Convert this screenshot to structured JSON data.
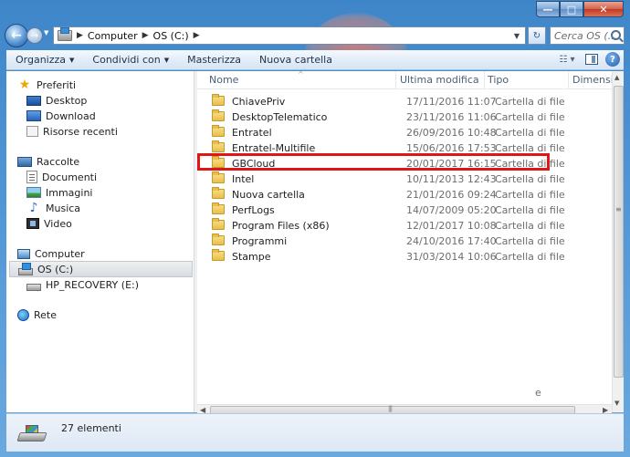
{
  "window": {
    "caption_buttons": {
      "minimize": "—",
      "maximize": "□",
      "close": "✕"
    }
  },
  "address_bar": {
    "path": [
      "Computer",
      "OS (C:)"
    ],
    "search_placeholder": "Cerca OS (..."
  },
  "toolbar": {
    "organize_label": "Organizza",
    "share_label": "Condividi con",
    "burn_label": "Masterizza",
    "new_folder_label": "Nuova cartella"
  },
  "nav_pane": {
    "favorites_label": "Preferiti",
    "favorites": [
      "Desktop",
      "Download",
      "Risorse recenti"
    ],
    "libraries_label": "Raccolte",
    "libraries": [
      "Documenti",
      "Immagini",
      "Musica",
      "Video"
    ],
    "computer_label": "Computer",
    "drives": [
      "OS (C:)",
      "HP_RECOVERY (E:)"
    ],
    "network_label": "Rete"
  },
  "file_list": {
    "columns": {
      "name": "Nome",
      "modified": "Ultima modifica",
      "type": "Tipo",
      "size": "Dimensio"
    },
    "rows": [
      {
        "name": "ChiavePriv",
        "modified": "17/11/2016 11:07",
        "type": "Cartella di file"
      },
      {
        "name": "DesktopTelematico",
        "modified": "23/11/2016 11:06",
        "type": "Cartella di file"
      },
      {
        "name": "Entratel",
        "modified": "26/09/2016 10:48",
        "type": "Cartella di file"
      },
      {
        "name": "Entratel-Multifile",
        "modified": "15/06/2016 17:53",
        "type": "Cartella di file"
      },
      {
        "name": "GBCloud",
        "modified": "20/01/2017 16:15",
        "type": "Cartella di file"
      },
      {
        "name": "Intel",
        "modified": "10/11/2013 12:43",
        "type": "Cartella di file"
      },
      {
        "name": "Nuova cartella",
        "modified": "21/01/2016 09:24",
        "type": "Cartella di file"
      },
      {
        "name": "PerfLogs",
        "modified": "14/07/2009 05:20",
        "type": "Cartella di file"
      },
      {
        "name": "Program Files (x86)",
        "modified": "12/01/2017 10:08",
        "type": "Cartella di file"
      },
      {
        "name": "Programmi",
        "modified": "24/10/2016 17:40",
        "type": "Cartella di file"
      },
      {
        "name": "Stampe",
        "modified": "31/03/2014 10:06",
        "type": "Cartella di file"
      }
    ],
    "trailing_char": "e",
    "highlighted_row": "GBCloud",
    "highlight_color": "#e01616"
  },
  "status_bar": {
    "item_count": "27 elementi"
  }
}
